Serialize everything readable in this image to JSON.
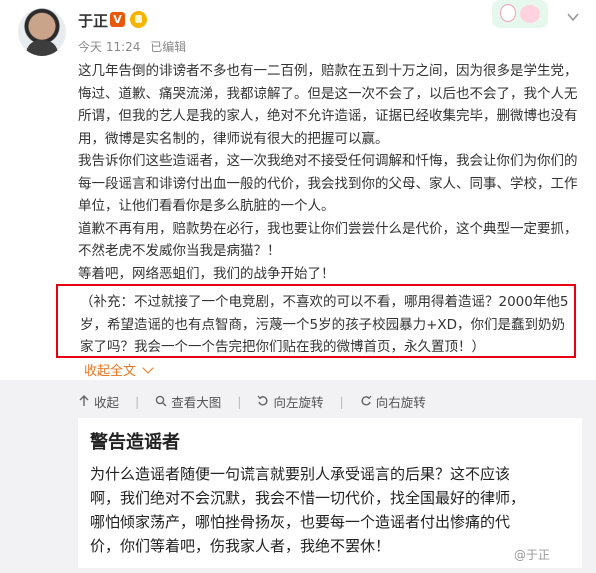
{
  "author": {
    "name": "于正",
    "verified_badge": "V",
    "time": "今天 11:24",
    "edited": "已编辑"
  },
  "post": {
    "paragraphs": [
      "这几年告倒的诽谤者不多也有一二百例，赔款在五到十万之间，因为很多是学生党，悔过、道歉、痛哭流涕，我都谅解了。但是这一次不会了，以后也不会了，我个人无所谓，但我的艺人是我的家人，绝对不允许造谣，证据已经收集完毕，删微博也没有用，微博是实名制的，律师说有很大的把握可以赢。",
      "我告诉你们这些造谣者，这一次我绝对不接受任何调解和忏悔，我会让你们为你们的每一段谣言和诽谤付出血一般的代价，我会找到你的父母、家人、同事、学校，工作单位，让他们看看你是多么肮脏的一个人。",
      "道歉不再有用，赔款势在必行，我也要让你们尝尝什么是代价，这个典型一定要抓，不然老虎不发威你当我是病猫？！",
      "等着吧，网络恶蛆们，我们的战争开始了！"
    ],
    "supplement": "（补充：不过就接了一个电竞剧，不喜欢的可以不看，哪用得着造谣？2000年他5岁，希望造谣的也有点智商，污蔑一个5岁的孩子校园暴力+XD，你们是蠢到奶奶家了吗？我会一个一个告完把你们贴在我的微博首页，永久置顶！）",
    "collapse_label": "收起全文"
  },
  "toolbar": {
    "collapse": "收起",
    "view_large": "查看大图",
    "rotate_left": "向左旋转",
    "rotate_right": "向右旋转"
  },
  "image_card": {
    "title": "警告造谣者",
    "body": "为什么造谣者随便一句谎言就要别人承受谣言的后果？这不应该啊，我们绝对不会沉默，我会不惜一切代价，找全国最好的律师，哪怕倾家荡产，哪怕挫骨扬灰，也要每一个造谣者付出惨痛的代价，你们等着吧，伤我家人者，我绝不罢休！",
    "watermark": "@于正"
  },
  "colors": {
    "highlight_border": "#e60012",
    "link_orange": "#e87722",
    "vip_badge": "#e8590c"
  }
}
